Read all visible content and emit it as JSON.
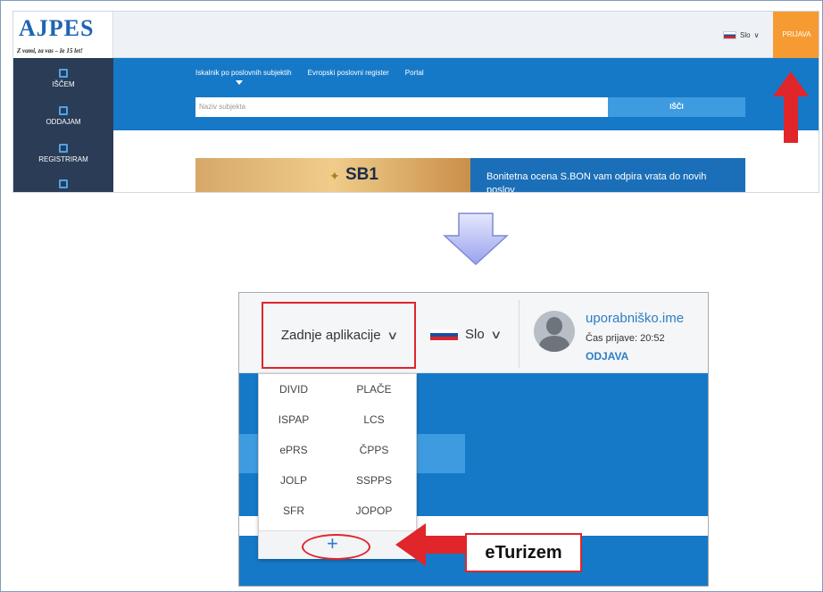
{
  "top": {
    "logo_text": "AJPES",
    "logo_tagline": "Z vami, za vas – že 15 let!",
    "language": "Slo",
    "login_button": "PRIJAVA",
    "nav_items": [
      "IŠČEM",
      "ODDAJAM",
      "REGISTRIRAM"
    ],
    "tabs": [
      "Iskalnik po poslovnih subjektih",
      "Evropski poslovni register",
      "Portal"
    ],
    "search_placeholder": "Naziv subjekta",
    "search_button": "IŠČI",
    "banner_logo": "SB1",
    "banner_text": "Bonitetna ocena S.BON vam odpira vrata do novih poslov"
  },
  "bottom": {
    "recent_apps_label": "Zadnje aplikacije",
    "language": "Slo",
    "username": "uporabniško.ime",
    "login_time": "Čas prijave: 20:52",
    "logout": "ODJAVA",
    "apps": [
      [
        "DIVID",
        "PLAČE"
      ],
      [
        "ISPAP",
        "LCS"
      ],
      [
        "ePRS",
        "ČPPS"
      ],
      [
        "JOLP",
        "SSPPS"
      ],
      [
        "SFR",
        "JOPOP"
      ]
    ],
    "add_symbol": "+"
  },
  "callout": {
    "label": "eTurizem"
  },
  "colors": {
    "accent_blue": "#1679c8",
    "login_orange": "#f59b32",
    "highlight_red": "#e0252b",
    "nav_dark": "#2a3c56"
  }
}
